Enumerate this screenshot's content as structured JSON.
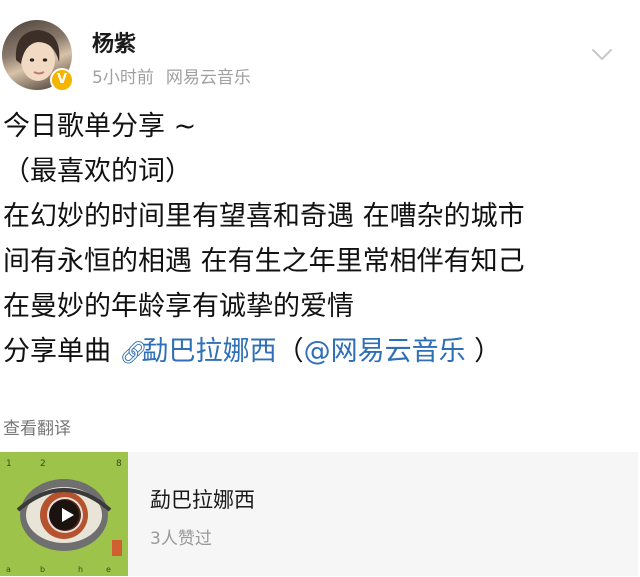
{
  "user": {
    "name": "杨紫",
    "time": "5小时前",
    "source": "网易云音乐",
    "verified_badge": "V"
  },
  "post": {
    "lines": [
      "今日歌单分享 ~",
      "（最喜欢的词）",
      "在幻妙的时间里有望喜和奇遇 在嘈杂的城市",
      "间有永恒的相遇 在有生之年里常相伴有知己",
      "在曼妙的年龄享有诚挚的爱情"
    ],
    "share_prefix": "分享单曲",
    "song_link_icon": "link-icon",
    "song_link": "勐巴拉娜西",
    "source_open": "（",
    "source_link": "@网易云音乐",
    "source_close": " ）",
    "translate": "查看翻译"
  },
  "music_card": {
    "title": "勐巴拉娜西",
    "likes": "3人赞过",
    "cover_top_text": [
      "1",
      "2",
      "8"
    ],
    "cover_bottom_text": [
      "a",
      "b",
      "h",
      "e"
    ]
  },
  "colors": {
    "link": "#2f6fb8",
    "badge": "#f5b400",
    "cover": "#9dc34a",
    "meta": "#a0a0a0"
  },
  "icons": {
    "chevron": "chevron-down-icon",
    "play": "play-icon",
    "verified": "verified-badge-icon"
  }
}
